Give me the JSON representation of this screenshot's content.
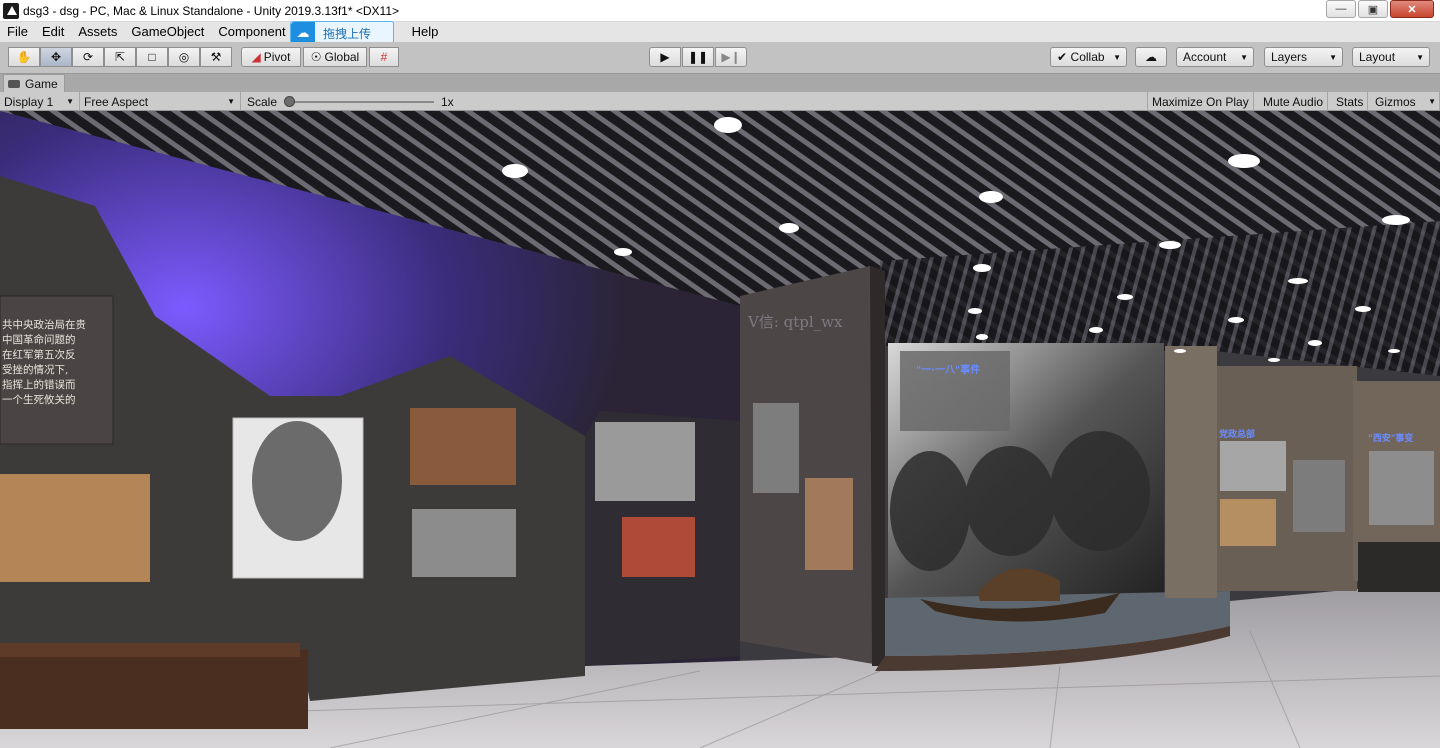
{
  "window": {
    "title": "dsg3 - dsg - PC, Mac & Linux Standalone - Unity 2019.3.13f1* <DX11>",
    "controls": [
      "minimize-icon",
      "maximize-icon",
      "close-icon"
    ]
  },
  "menu": {
    "items": [
      "File",
      "Edit",
      "Assets",
      "GameObject",
      "Component",
      "Help"
    ]
  },
  "upload_badge": {
    "label": "拖拽上传",
    "icon": "cloud-upload-icon"
  },
  "toolbar": {
    "tools": [
      "hand-tool-icon",
      "move-tool-icon",
      "rotate-tool-icon",
      "scale-tool-icon",
      "rect-tool-icon",
      "transform-tool-icon",
      "custom-tool-icon"
    ],
    "pivot_label": "Pivot",
    "global_label": "Global",
    "collab_label": "Collab",
    "account_label": "Account",
    "layers_label": "Layers",
    "layout_label": "Layout"
  },
  "game_tab": {
    "label": "Game"
  },
  "game_bar": {
    "display": "Display 1",
    "aspect": "Free Aspect",
    "scale_label": "Scale",
    "scale_value": "1x",
    "scale_slider_fraction": 0.0,
    "maximize": "Maximize On Play",
    "mute": "Mute Audio",
    "stats": "Stats",
    "gizmos": "Gizmos"
  },
  "scene": {
    "wall_text": [
      "共中央政治局在贵",
      "中国革命问题的",
      "在红军第五次反",
      "受挫的情况下,",
      "指挥上的错误而",
      "一个生死攸关的"
    ],
    "watermark": "V信: qtpl_wx",
    "exhibit_caption_main": "\"一·一八\"事件",
    "exhibit_caption_right1": "党政总部",
    "exhibit_caption_right2": "\"西安\"事变",
    "colors": {
      "accent_light": "#6e4fff",
      "ceiling": "#18171b",
      "floor": "#bdbabd"
    }
  }
}
